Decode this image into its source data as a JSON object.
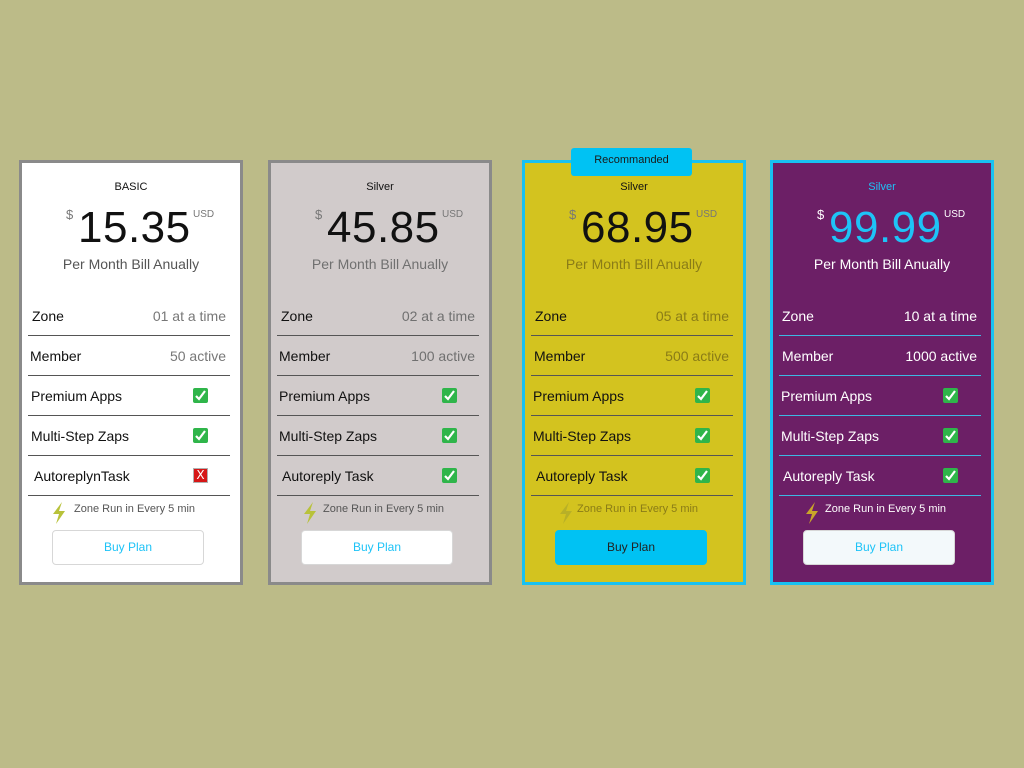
{
  "plans": [
    {
      "name": "BASIC",
      "currency": "$",
      "price": "15.35",
      "unit": "USD",
      "billing": "Per Month Bill Anually",
      "features": [
        {
          "label": "Zone",
          "value": "01 at a time"
        },
        {
          "label": "Member",
          "value": "50 active"
        },
        {
          "label": "Premium Apps",
          "included": true
        },
        {
          "label": "Multi-Step Zaps",
          "included": true
        },
        {
          "label": "AutoreplynTask",
          "included": false
        }
      ],
      "zone_run": "Zone Run in Every 5 min",
      "button": "Buy Plan"
    },
    {
      "name": "Silver",
      "currency": "$",
      "price": "45.85",
      "unit": "USD",
      "billing": "Per Month Bill Anually",
      "features": [
        {
          "label": "Zone",
          "value": "02 at a time"
        },
        {
          "label": "Member",
          "value": "100 active"
        },
        {
          "label": "Premium Apps",
          "included": true
        },
        {
          "label": "Multi-Step Zaps",
          "included": true
        },
        {
          "label": "Autoreply Task",
          "included": true
        }
      ],
      "zone_run": "Zone Run in Every 5 min",
      "button": "Buy Plan"
    },
    {
      "badge": "Recommanded",
      "name": "Silver",
      "currency": "$",
      "price": "68.95",
      "unit": "USD",
      "billing": "Per Month Bill Anually",
      "features": [
        {
          "label": "Zone",
          "value": "05 at a time"
        },
        {
          "label": "Member",
          "value": "500 active"
        },
        {
          "label": "Premium Apps",
          "included": true
        },
        {
          "label": "Multi-Step Zaps",
          "included": true
        },
        {
          "label": "Autoreply Task",
          "included": true
        }
      ],
      "zone_run": "Zone Run in Every 5 min",
      "button": "Buy Plan"
    },
    {
      "name": "Silver",
      "currency": "$",
      "price": "99.99",
      "unit": "USD",
      "billing": "Per Month Bill Anually",
      "features": [
        {
          "label": "Zone",
          "value": "10 at a time"
        },
        {
          "label": "Member",
          "value": "1000 active"
        },
        {
          "label": "Premium Apps",
          "included": true
        },
        {
          "label": "Multi-Step Zaps",
          "included": true
        },
        {
          "label": "Autoreply Task",
          "included": true
        }
      ],
      "zone_run": "Zone Run in Every 5 min",
      "button": "Buy Plan"
    }
  ],
  "colors": {
    "background": "#bcbb88",
    "accent": "#00c2f3",
    "check": "#2fb54a",
    "cross": "#d61616"
  }
}
